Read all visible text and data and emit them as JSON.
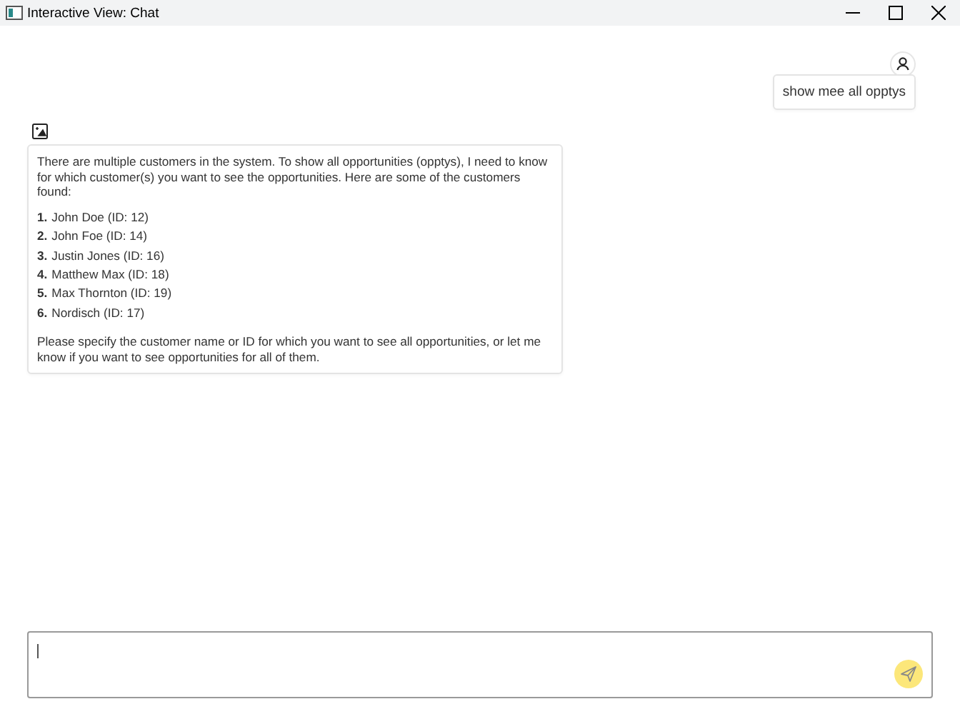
{
  "window": {
    "title": "Interactive View: Chat"
  },
  "messages": [
    {
      "kind": "user",
      "text": "show mee all opptys"
    },
    {
      "kind": "bot",
      "intro": "There are multiple customers in the system. To show all opportunities (opptys), I need to know for which customer(s) you want to see the opportunities. Here are some of the customers found:",
      "list": [
        {
          "number": "1.",
          "text": "John Doe (ID: 12)"
        },
        {
          "number": "2.",
          "text": "John Foe (ID: 14)"
        },
        {
          "number": "3.",
          "text": "Justin Jones (ID: 16)"
        },
        {
          "number": "4.",
          "text": "Matthew Max (ID: 18)"
        },
        {
          "number": "5.",
          "text": "Max Thornton (ID: 19)"
        },
        {
          "number": "6.",
          "text": "Nordisch (ID: 17)"
        }
      ],
      "outro": "Please specify the customer name or ID for which you want to see all opportunities, or let me know if you want to see opportunities for all of them."
    }
  ]
}
